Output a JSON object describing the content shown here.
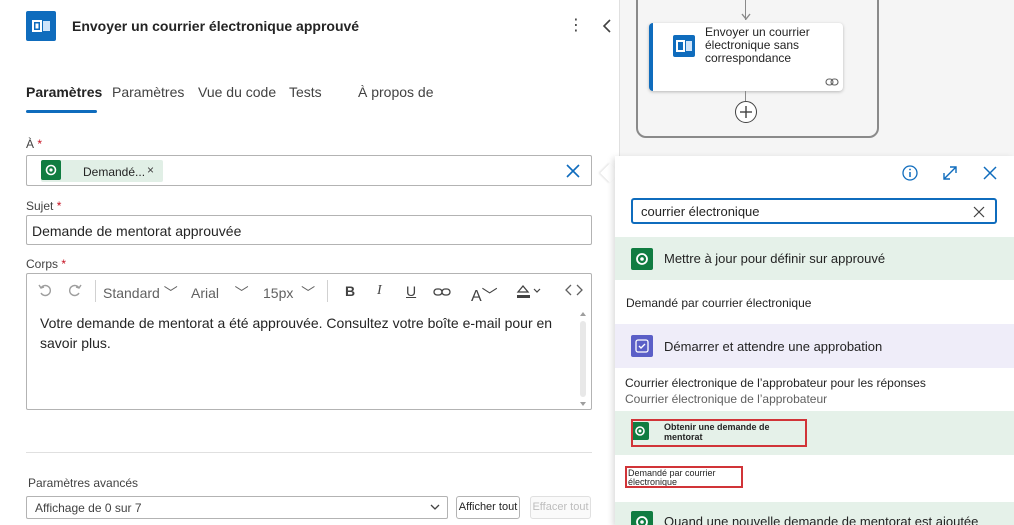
{
  "header": {
    "title": "Envoyer un courrier électronique approuvé",
    "icon": "outlook-icon"
  },
  "tabs": [
    {
      "label": "Paramètres",
      "active": true
    },
    {
      "label": "Paramètres",
      "active": false
    },
    {
      "label": "Vue du code",
      "active": false
    },
    {
      "label": "Tests",
      "active": false
    },
    {
      "label": "À propos de",
      "active": false
    }
  ],
  "to": {
    "label": "À",
    "required": "*",
    "chip": "Demandé...",
    "chip_close": "×"
  },
  "subject": {
    "label": "Sujet",
    "required": "*",
    "value": "Demande de mentorat approuvée"
  },
  "body": {
    "label": "Corps",
    "required": "*",
    "toolbar": {
      "format": "Standard",
      "font": "Arial",
      "size": "15px"
    },
    "text": "Votre demande de mentorat a été approuvée. Consultez votre boîte e-mail pour en savoir plus."
  },
  "advanced": {
    "label": "Paramètres avancés",
    "select": "Affichage de 0 sur 7",
    "show_all": "Afficher tout",
    "clear_all": "Effacer tout"
  },
  "canvas": {
    "card_title": "Envoyer un courrier électronique sans correspondance"
  },
  "flyout": {
    "search_value": "courrier électronique",
    "sections": [
      {
        "title": "Mettre à jour pour définir sur approuvé",
        "color": "#107c41",
        "items": [
          {
            "label": "Demandé par courrier électronique"
          }
        ]
      },
      {
        "title": "Démarrer et attendre une approbation",
        "color": "#5b5fc7",
        "items": [
          {
            "label": "Courrier électronique de l’approbateur pour les réponses",
            "sub": "Courrier électronique de l’approbateur"
          }
        ]
      },
      {
        "title": "Obtenir une demande de mentorat",
        "color": "#107c41",
        "items": [
          {
            "label": "Demandé par courrier électronique"
          }
        ]
      },
      {
        "title": "Quand une nouvelle demande de mentorat est ajoutée",
        "color": "#107c41",
        "items": []
      }
    ]
  },
  "colors": {
    "accent": "#0f6cbd",
    "dataverse": "#107c41",
    "approvals": "#5b5fc7",
    "highlight": "#d13438"
  }
}
